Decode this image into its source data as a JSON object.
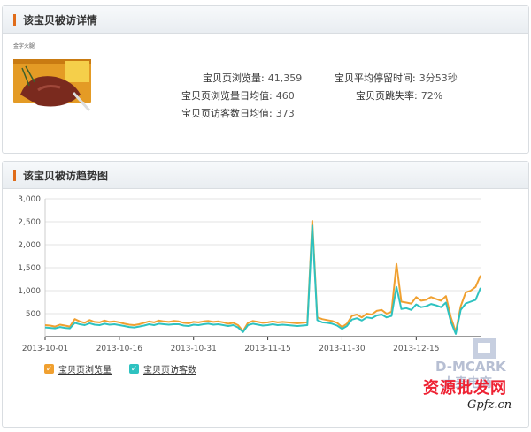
{
  "panel1": {
    "title": "该宝贝被访详情",
    "product_brand": "金字火腿",
    "stats": [
      {
        "label": "宝贝页浏览量:",
        "value": "41,359"
      },
      {
        "label": "宝贝页浏览量日均值:",
        "value": "460"
      },
      {
        "label": "宝贝页访客数日均值:",
        "value": "373"
      },
      {
        "label": "宝贝平均停留时间:",
        "value": "3分53秒"
      },
      {
        "label": "宝贝页跳失率:",
        "value": "72%"
      }
    ]
  },
  "panel2": {
    "title": "该宝贝被访趋势图"
  },
  "chart_data": {
    "type": "line",
    "x_ticks": [
      "2013-10-01",
      "2013-10-16",
      "2013-10-31",
      "2013-11-15",
      "2013-11-30",
      "2013-12-15"
    ],
    "y_ticks": [
      "3,000",
      "2,500",
      "2,000",
      "1,500",
      "1,000",
      "500"
    ],
    "ylim": [
      0,
      3000
    ],
    "grid": true,
    "legend": "bottom-left",
    "series": [
      {
        "name": "宝贝页浏览量",
        "color": "#f0a030",
        "values": [
          250,
          240,
          220,
          260,
          240,
          220,
          380,
          330,
          300,
          360,
          320,
          310,
          350,
          320,
          330,
          310,
          280,
          260,
          250,
          270,
          300,
          330,
          310,
          350,
          330,
          320,
          340,
          330,
          300,
          290,
          320,
          310,
          330,
          340,
          320,
          330,
          310,
          280,
          300,
          250,
          120,
          300,
          340,
          320,
          300,
          310,
          330,
          310,
          320,
          310,
          300,
          290,
          300,
          310,
          2520,
          420,
          380,
          360,
          340,
          300,
          210,
          280,
          450,
          480,
          420,
          500,
          480,
          560,
          580,
          500,
          540,
          1580,
          760,
          740,
          720,
          860,
          780,
          800,
          860,
          820,
          780,
          880,
          420,
          100,
          660,
          960,
          1000,
          1080,
          1330
        ]
      },
      {
        "name": "宝贝页访客数",
        "color": "#2ec2c0",
        "values": [
          200,
          190,
          180,
          210,
          190,
          180,
          300,
          270,
          250,
          290,
          260,
          250,
          280,
          260,
          270,
          250,
          230,
          210,
          200,
          220,
          240,
          270,
          250,
          280,
          270,
          260,
          270,
          270,
          240,
          230,
          260,
          250,
          270,
          280,
          260,
          270,
          250,
          230,
          250,
          200,
          100,
          250,
          280,
          260,
          240,
          250,
          270,
          250,
          260,
          250,
          240,
          230,
          240,
          250,
          2420,
          360,
          310,
          300,
          280,
          240,
          170,
          230,
          370,
          400,
          350,
          420,
          400,
          460,
          480,
          420,
          450,
          1080,
          600,
          620,
          580,
          700,
          640,
          660,
          710,
          680,
          640,
          740,
          320,
          60,
          580,
          720,
          760,
          800,
          1060
        ]
      }
    ]
  },
  "watermark": {
    "brand": "D-MCARK",
    "brand_cn": "大麦电商",
    "site_cn": "资源批发网",
    "site_url": "Gpfz.cn"
  },
  "colors": {
    "accent": "#e06c1a",
    "series1": "#f0a030",
    "series2": "#2ec2c0"
  }
}
